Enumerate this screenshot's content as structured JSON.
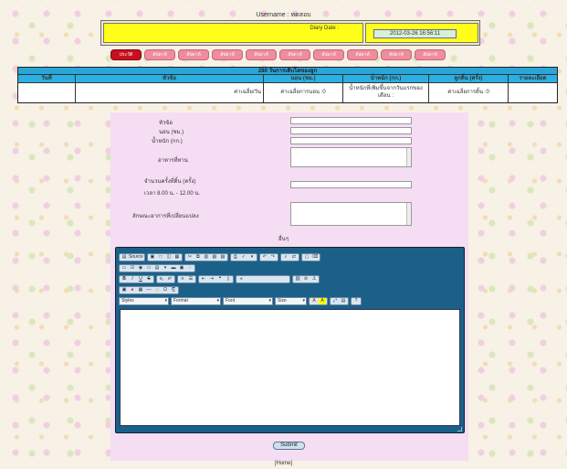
{
  "header": {
    "username": "Username : ทดสอบ",
    "diary_date_label": "Diary Date :",
    "diary_date_value": "2012-03-26 16:56:11"
  },
  "tabs": [
    {
      "label": "ประวัติ",
      "active": true
    },
    {
      "label": "สัปดาห์",
      "active": false
    },
    {
      "label": "สัปดาห์",
      "active": false
    },
    {
      "label": "สัปดาห์",
      "active": false
    },
    {
      "label": "สัปดาห์",
      "active": false
    },
    {
      "label": "สัปดาห์",
      "active": false
    },
    {
      "label": "สัปดาห์",
      "active": false
    },
    {
      "label": "สัปดาห์",
      "active": false
    },
    {
      "label": "สัปดาห์",
      "active": false
    },
    {
      "label": "สัปดาห์",
      "active": false
    }
  ],
  "info_table": {
    "title": "280 วันการเติบโตของลูก",
    "columns": [
      "วันที่",
      "หัวข้อ",
      "นอน (ชม.)",
      "น้ำหนัก (กก.)",
      "ลูกดิ้น (ครั้ง)",
      "รายละเอียด"
    ],
    "row": {
      "date": "",
      "topic": "ค่าเฉลี่ย/วัน",
      "sleep": "ค่าเฉลี่ยการนอน :0",
      "weight": "น้ำหนักที่เพิ่มขึ้นจากวันแรกของเดือน :",
      "kicks": "ค่าเฉลี่ยการดิ้น :0",
      "details": ""
    }
  },
  "form": {
    "topic_label": "หัวข้อ",
    "sleep_label": "นอน (ชม.)",
    "weight_label": "น้ำหนัก (กก.)",
    "food_label": "อาหารที่ทาน",
    "kicks_label": "จำนวนครั้งที่ดิ้น (ครั้ง)",
    "kicks_time": "เวลา 8.00 น. - 12.00 น.",
    "mood_label": "ลักษณะอาการที่เปลี่ยนแปลง",
    "other_label": "อื่นๆ"
  },
  "editor": {
    "source_label": "Source",
    "styles_label": "Styles",
    "format_label": "Format",
    "font_label": "Font",
    "size_label": "Size"
  },
  "submit_label": "Submit",
  "home_label": "[Home]"
}
